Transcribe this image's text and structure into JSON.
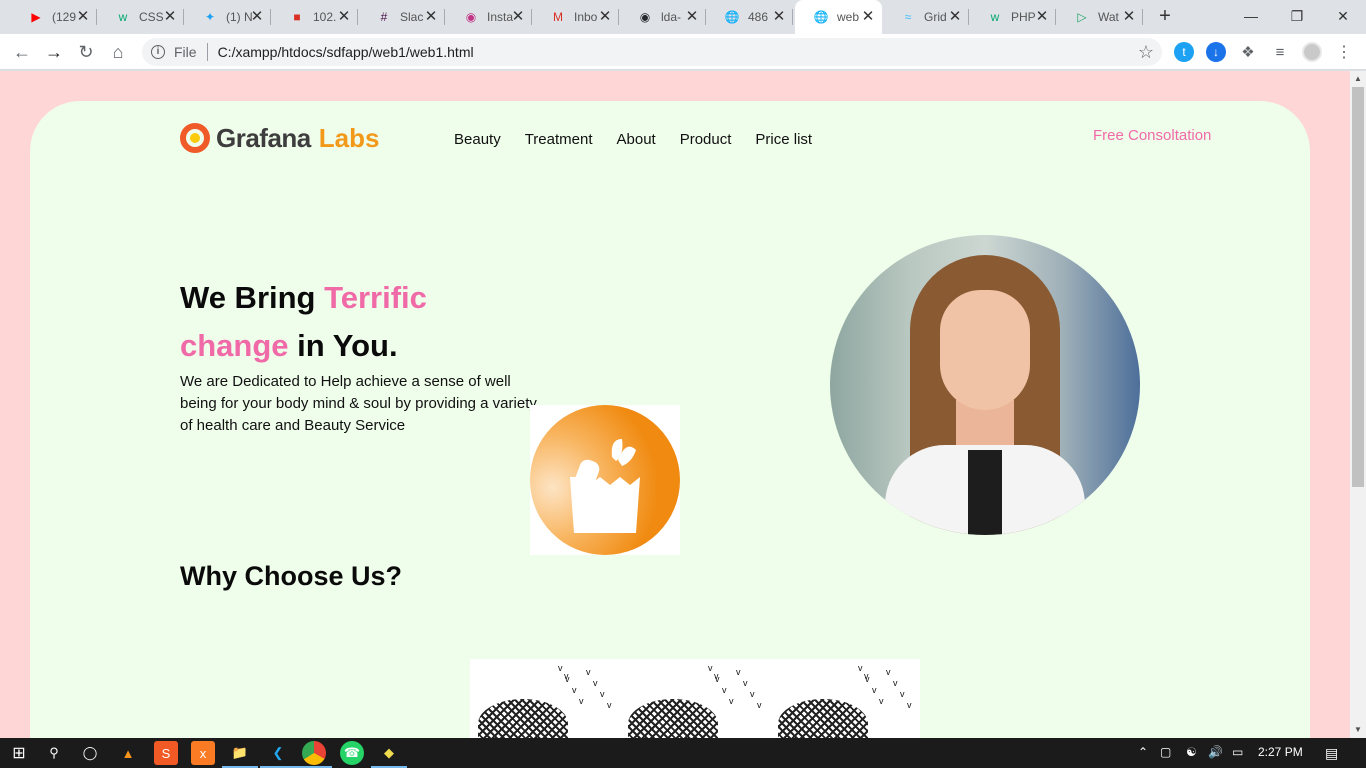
{
  "browser": {
    "tabs": [
      {
        "title": "(129",
        "icon": "youtube-icon",
        "color": "#ff0000"
      },
      {
        "title": "CSS",
        "icon": "w3schools-icon",
        "color": "#04aa6d"
      },
      {
        "title": "(1) N",
        "icon": "twitter-icon",
        "color": "#1da1f2"
      },
      {
        "title": "102.",
        "icon": "site-icon",
        "color": "#d93025"
      },
      {
        "title": "Slac",
        "icon": "slack-icon",
        "color": "#4a154b"
      },
      {
        "title": "Insta",
        "icon": "instagram-icon",
        "color": "#c13584"
      },
      {
        "title": "Inbo",
        "icon": "gmail-icon",
        "color": "#d93025"
      },
      {
        "title": "lda-",
        "icon": "github-icon",
        "color": "#24292e"
      },
      {
        "title": "486",
        "icon": "globe-icon",
        "color": "#5f6368"
      },
      {
        "title": "web",
        "icon": "globe-icon",
        "color": "#5f6368",
        "active": true
      },
      {
        "title": "Grid",
        "icon": "tailwind-icon",
        "color": "#38bdf8"
      },
      {
        "title": "PHP",
        "icon": "w3schools-icon",
        "color": "#04aa6d"
      },
      {
        "title": "Wat",
        "icon": "play-icon",
        "color": "#1aa260"
      }
    ],
    "new_tab": "+",
    "address": {
      "scheme_label": "File",
      "url": "C:/xampp/htdocs/sdfapp/web1/web1.html"
    }
  },
  "site": {
    "logo": {
      "name": "Grafana",
      "suffix": "Labs"
    },
    "nav": [
      "Beauty",
      "Treatment",
      "About",
      "Product",
      "Price list"
    ],
    "cta": "Free Consoltation",
    "hero": {
      "line1_plain": "We Bring ",
      "line1_pink": "Terrific",
      "line2_pink": "change",
      "line2_plain": " in You.",
      "lead": "We are Dedicated to Help achieve a sense of well being for your body mind & soul by providing a variety of health care and Beauty Service"
    },
    "why_title": "Why Choose Us?"
  },
  "taskbar": {
    "time": "2:27 PM"
  }
}
